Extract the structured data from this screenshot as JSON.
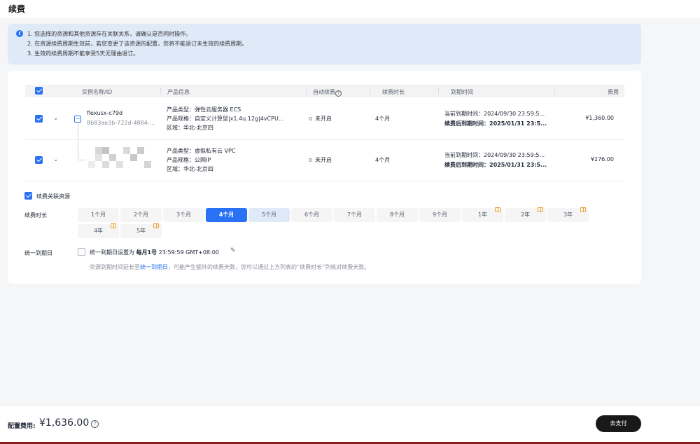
{
  "page": {
    "title": "续费"
  },
  "notice": {
    "lines": [
      "1. 您选择的资源和其他资源存在关联关系，请确认是否同时操作。",
      "2. 在资源续费周期生效前，若您变更了该资源的配置，您将不能退订未生效的续费周期。",
      "3. 生效的续费周期不能享受5天无理由退订。"
    ]
  },
  "table": {
    "headers": {
      "instance": "实例名称/ID",
      "product": "产品信息",
      "auto_renew": "自动续费",
      "duration": "续费时长",
      "expire": "到期时间",
      "fee": "费用"
    },
    "help_glyph": "?",
    "rows": [
      {
        "name": "flexusx-c79d",
        "id": "8b83ae3b-722d-4884-...",
        "tree_toggle": "−",
        "product_type": "产品类型：弹性云服务器 ECS",
        "product_spec": "产品规格：自定义计算型|x1.4u.12g|4vCPU...",
        "region": "区域：华北-北京四",
        "auto_renew": "未开启",
        "duration": "4个月",
        "current_expire": "当前到期时间：2024/09/30 23:59:5...",
        "renewed_expire": "续费后到期时间：2025/01/31 23:5...",
        "fee": "¥1,360.00"
      },
      {
        "product_type": "产品类型：虚拟私有云 VPC",
        "product_spec": "产品规格：公网IP",
        "region": "区域：华北-北京四",
        "auto_renew": "未开启",
        "duration": "4个月",
        "current_expire": "当前到期时间：2024/09/30 23:59:5...",
        "renewed_expire": "续费后到期时间：2025/01/31 23:5...",
        "fee": "¥276.00"
      }
    ]
  },
  "renew_related": {
    "label": "续费关联资源",
    "checked": true
  },
  "duration": {
    "label": "续费时长",
    "options": [
      "1个月",
      "2个月",
      "3个月",
      "4个月",
      "5个月",
      "6个月",
      "7个月",
      "8个月",
      "9个月",
      "1年",
      "2年",
      "3年",
      "4年",
      "5年"
    ],
    "selected": "4个月"
  },
  "unify": {
    "label": "统一到期日",
    "text_prefix": "统一到期日设置为 ",
    "text_bold": "每月1号",
    "text_suffix": " 23:59:59 GMT+08:00",
    "hint_prefix": "资源到期时间延长至",
    "hint_link": "统一到期日",
    "hint_suffix": "，可能产生额外的续费天数，您可以通过上方列表的“续费时长”列核对续费天数。",
    "pencil_glyph": "✎"
  },
  "footer": {
    "total_label": "配置费用:",
    "total_value": "¥1,636.00",
    "help_glyph": "?",
    "pay_button": "去支付"
  },
  "colors": {
    "primary": "#2a72f5",
    "notice_bg": "#dfeaf9",
    "pay_button": "#191919"
  }
}
